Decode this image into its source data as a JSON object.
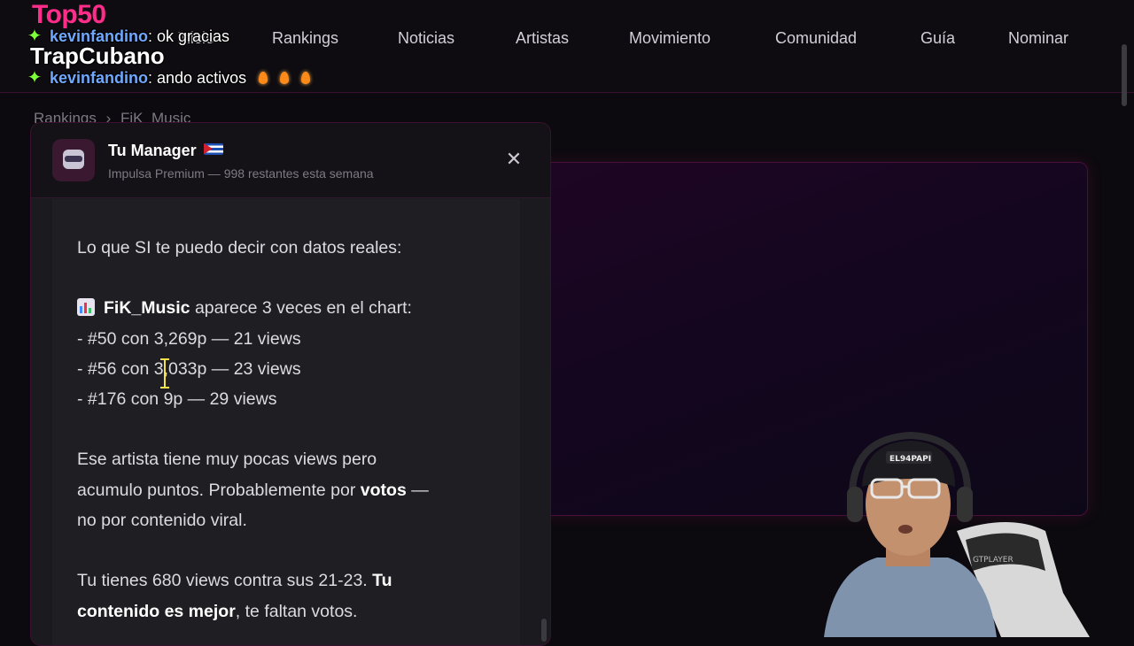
{
  "overlay": {
    "logo_top": "Top50",
    "logo_bottom": "TrapCubano",
    "chat": [
      {
        "user": "kevinfandino",
        "message": ": ok gracias"
      },
      {
        "user": "kevinfandino",
        "message": ": ando activos"
      }
    ]
  },
  "nav": {
    "items": [
      "Inicio",
      "Rankings",
      "Noticias",
      "Artistas",
      "Movimiento",
      "Comunidad",
      "Guía",
      "Nominar"
    ]
  },
  "breadcrumb": {
    "parent": "Rankings",
    "separator": "›",
    "current": "FiK_Music"
  },
  "manager": {
    "title": "Tu Manager",
    "subtitle": "Impulsa Premium — 998 restantes esta semana",
    "close_icon": "close-icon",
    "message": {
      "intro": "Lo que SI te puedo decir con datos reales:",
      "chart_prefix_icon": "bar-chart-icon",
      "artist": "FiK_Music",
      "artist_suffix": " aparece 3 veces en el chart:",
      "entries": [
        "- #50 con 3,269p — 21 views",
        "- #56 con 3,033p — 23 views",
        "- #176 con 9p — 29 views"
      ],
      "para2_a": "Ese artista tiene muy pocas views pero",
      "para2_b_pre": "acumulo puntos. Probablemente por ",
      "para2_b_bold": "votos",
      "para2_b_post": " —",
      "para2_c": "no por contenido viral.",
      "para3_a_pre": "Tu tienes 680 views contra sus 21-23. ",
      "para3_a_bold": "Tu",
      "para3_b_bold": "contenido es mejor",
      "para3_b_post": ", te faltan votos."
    }
  },
  "webcam": {
    "cap_text": "EL94PAPI",
    "chair_text": "GTPLAYER"
  },
  "colors": {
    "accent": "#ff2d8a",
    "chat_user": "#6fa8ff",
    "cursor": "#f2e14a"
  }
}
